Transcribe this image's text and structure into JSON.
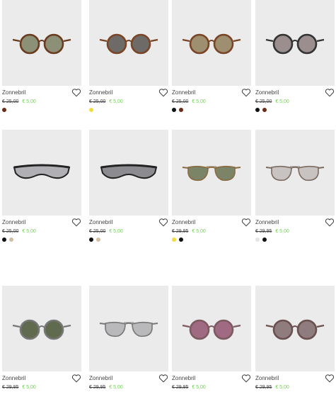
{
  "products": [
    {
      "name": "Zonnebril",
      "old_price": "€ 25,00",
      "new_price": "€ 5,00",
      "frame": "round",
      "frame_color": "#6b3b1f",
      "lens_color": "#8b9076",
      "swatches": [
        "#6b2b16"
      ]
    },
    {
      "name": "Zonnebril",
      "old_price": "€ 25,00",
      "new_price": "€ 5,00",
      "frame": "round",
      "frame_color": "#7a4526",
      "lens_color": "#6e6a68",
      "swatches": [
        "#f0dc3c"
      ]
    },
    {
      "name": "Zonnebril",
      "old_price": "€ 25,00",
      "new_price": "€ 5,00",
      "frame": "round",
      "frame_color": "#7a4526",
      "lens_color": "#9d8f70",
      "swatches": [
        "#111111",
        "#6b2b16"
      ]
    },
    {
      "name": "Zonnebril",
      "old_price": "€ 25,00",
      "new_price": "€ 5,00",
      "frame": "round",
      "frame_color": "#333333",
      "lens_color": "#9a8e8e",
      "swatches": [
        "#111111",
        "#6b2b16"
      ]
    },
    {
      "name": "Zonnebril",
      "old_price": "€ 25,00",
      "new_price": "€ 5,00",
      "frame": "sport",
      "frame_color": "#222222",
      "lens_color": "#b0b0b4",
      "swatches": [
        "#111111",
        "#d2bfa3"
      ]
    },
    {
      "name": "Zonnebril",
      "old_price": "€ 25,00",
      "new_price": "€ 5,00",
      "frame": "sport",
      "frame_color": "#222222",
      "lens_color": "#8c8c90",
      "swatches": [
        "#111111",
        "#d2bfa3"
      ]
    },
    {
      "name": "Zonnebril",
      "old_price": "€ 29,95",
      "new_price": "€ 5,00",
      "frame": "aviator",
      "frame_color": "#8a6a40",
      "lens_color": "#7c8468",
      "swatches": [
        "#f0dc3c",
        "#111111"
      ]
    },
    {
      "name": "Zonnebril",
      "old_price": "€ 29,95",
      "new_price": "€ 5,00",
      "frame": "aviator",
      "frame_color": "#7a6a60",
      "lens_color": "#c8c3c0",
      "swatches": [
        "#e4e4e4",
        "#111111"
      ]
    },
    {
      "name": "Zonnebril",
      "old_price": "€ 29,95",
      "new_price": "€ 5,00",
      "frame": "round",
      "frame_color": "#777777",
      "lens_color": "#5f6a4e",
      "swatches": []
    },
    {
      "name": "Zonnebril",
      "old_price": "€ 29,95",
      "new_price": "€ 5,00",
      "frame": "aviator",
      "frame_color": "#777777",
      "lens_color": "#b9b9bb",
      "swatches": []
    },
    {
      "name": "Zonnebril",
      "old_price": "€ 29,95",
      "new_price": "€ 5,00",
      "frame": "round",
      "frame_color": "#7b5a60",
      "lens_color": "#a06a82",
      "swatches": []
    },
    {
      "name": "Zonnebril",
      "old_price": "€ 29,95",
      "new_price": "€ 5,00",
      "frame": "round",
      "frame_color": "#6b5050",
      "lens_color": "#8f7c7e",
      "swatches": []
    }
  ],
  "icons": {
    "favorite": "heart-outline-icon"
  }
}
